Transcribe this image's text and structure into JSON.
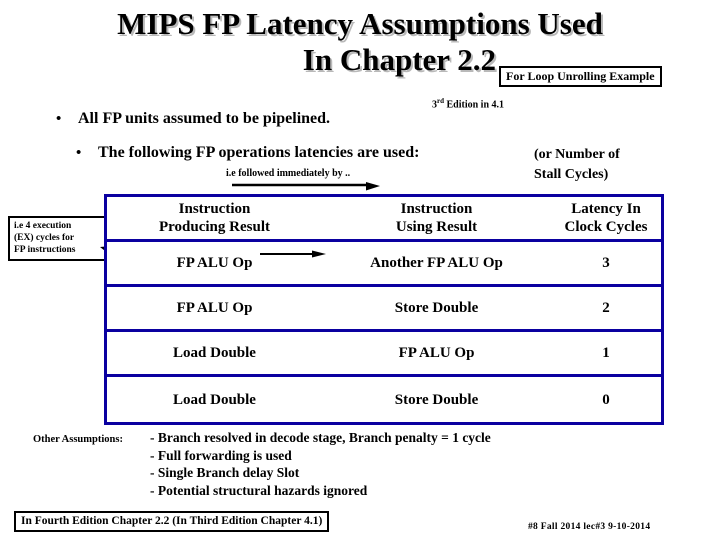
{
  "slide": {
    "title_line1": "MIPS FP Latency Assumptions Used",
    "title_line2": "In Chapter 2.2",
    "unrolling_box": "For Loop Unrolling Example",
    "edition_note_prefix": "3",
    "edition_note_sup": "rd",
    "edition_note_rest": " Edition in 4.1",
    "bullets": [
      {
        "marker": "•",
        "text": "All FP units assumed to be pipelined."
      },
      {
        "marker": "•",
        "text": "The following  FP operations latencies are used:"
      }
    ],
    "stall_note_line1": "(or Number of",
    "stall_note_line2": "Stall  Cycles)",
    "follow_note": "i.e followed immediately by ..",
    "ex_callout_line1": "i.e 4 execution",
    "ex_callout_line2": "(EX) cycles for",
    "ex_callout_line3": "FP instructions",
    "other_assumptions_label": "Other Assumptions:",
    "other_assumptions": [
      "- Branch resolved in decode stage,  Branch penalty = 1 cycle",
      "- Full forwarding is used",
      "- Single Branch delay Slot",
      "- Potential structural hazards ignored"
    ],
    "footer_box": "In Fourth Edition Chapter 2.2 (In Third Edition Chapter 4.1)",
    "footer_right": "#8   Fall 2014 lec#3   9-10-2014",
    "colors": {
      "table_border": "#0a00a0",
      "text": "#000000",
      "title_shadow": "#b9b9b9",
      "arrow": "#000000"
    }
  },
  "chart_data": {
    "type": "table",
    "title": "MIPS FP Latency Assumptions Used In Chapter 2.2",
    "columns": [
      {
        "line1": "Instruction",
        "line2": "Producing Result"
      },
      {
        "line1": "Instruction",
        "line2": "Using Result"
      },
      {
        "line1": "Latency In",
        "line2": "Clock Cycles"
      }
    ],
    "rows": [
      {
        "producing": "FP ALU Op",
        "using": "Another FP ALU Op",
        "latency": "3"
      },
      {
        "producing": "FP ALU Op",
        "using": "Store Double",
        "latency": "2"
      },
      {
        "producing": "Load Double",
        "using": "FP ALU Op",
        "latency": "1"
      },
      {
        "producing": "Load Double",
        "using": "Store Double",
        "latency": "0"
      }
    ]
  }
}
